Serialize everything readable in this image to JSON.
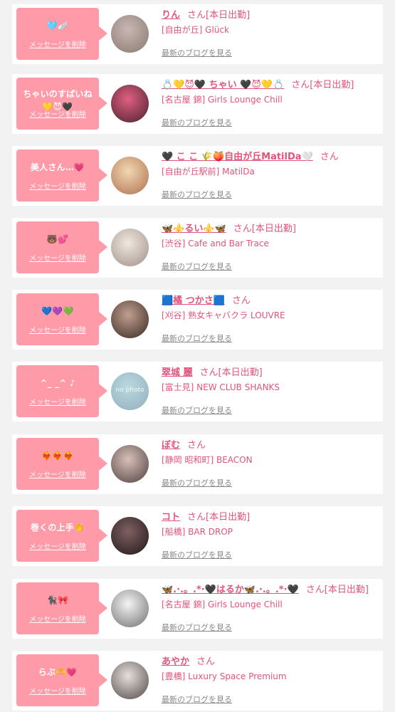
{
  "delete_label": "メッセージを削除",
  "blog_label": "最新のブログを見る",
  "san_label": "さん",
  "colors": {
    "background": "#f2f2f2",
    "bubble": "#ff9aa8",
    "accent": "#e0557c",
    "muted": "#888888"
  },
  "cards": [
    {
      "message": "🩵🪽",
      "name": "りん",
      "badge": "[本日出勤]",
      "shop": "[自由が丘] Glück",
      "avatar": {
        "c1": "#c8b8b4",
        "c2": "#8a7870",
        "text": ""
      }
    },
    {
      "message": "ちゃいのすぱいね\n💛😈🖤",
      "name": "💍💛😈🖤 ちゃい 🖤😈💛💍",
      "badge": "[本日出勤]",
      "shop": "[名古屋 錦] Girls Lounge Chill",
      "avatar": {
        "c1": "#e06080",
        "c2": "#4a2030",
        "text": ""
      }
    },
    {
      "message": "美人さん…💗",
      "name": "🖤 こ こ 🌾🍑自由が丘MatilDa🤍",
      "badge": "",
      "shop": "[自由が丘駅前] MatilDa",
      "avatar": {
        "c1": "#f0d8b0",
        "c2": "#b07050",
        "text": ""
      }
    },
    {
      "message": "🐻💕",
      "name": "🦋⚜️るい⚜️🦋",
      "badge": "[本日出勤]",
      "shop": "[渋谷] Cafe and Bar Trace",
      "avatar": {
        "c1": "#f0e8e0",
        "c2": "#a09088",
        "text": ""
      }
    },
    {
      "message": "💙💜💚",
      "name": "🟦橘 つかさ🟦",
      "badge": "",
      "shop": "[刈谷] 熟女キャバクラ LOUVRE",
      "avatar": {
        "c1": "#c0a090",
        "c2": "#3a2820",
        "text": ""
      }
    },
    {
      "message": "^_ _^ ♪",
      "name": "翠城 麗",
      "badge": "[本日出勤]",
      "shop": "[富士見] NEW CLUB SHANKS",
      "avatar": {
        "c1": "#bcd8e0",
        "c2": "#8fb0bc",
        "text": "no photo"
      }
    },
    {
      "message": "❤️‍🔥❤️‍🔥❤️‍🔥",
      "name": "ぼむ",
      "badge": "",
      "shop": "[静岡 昭和町] BEACON",
      "avatar": {
        "c1": "#d8c0b8",
        "c2": "#504040",
        "text": ""
      }
    },
    {
      "message": "巻くの上手👏",
      "name": "コト",
      "badge": "[本日出勤]",
      "shop": "[船橋] BAR DROP",
      "avatar": {
        "c1": "#806060",
        "c2": "#201818",
        "text": ""
      }
    },
    {
      "message": "🐈‍⬛🎀",
      "name": "🦋.·.。.*·🖤はるか🦋.·.。.*·🖤",
      "badge": "[本日出勤]",
      "shop": "[名古屋 錦] Girls Lounge Chill",
      "avatar": {
        "c1": "#f4f4f4",
        "c2": "#707070",
        "text": ""
      }
    },
    {
      "message": "らぶ🫶💗",
      "name": "あやか",
      "badge": "",
      "shop": "[豊橋] Luxury Space Premium",
      "avatar": {
        "c1": "#e8e0dc",
        "c2": "#504848",
        "text": ""
      }
    }
  ]
}
